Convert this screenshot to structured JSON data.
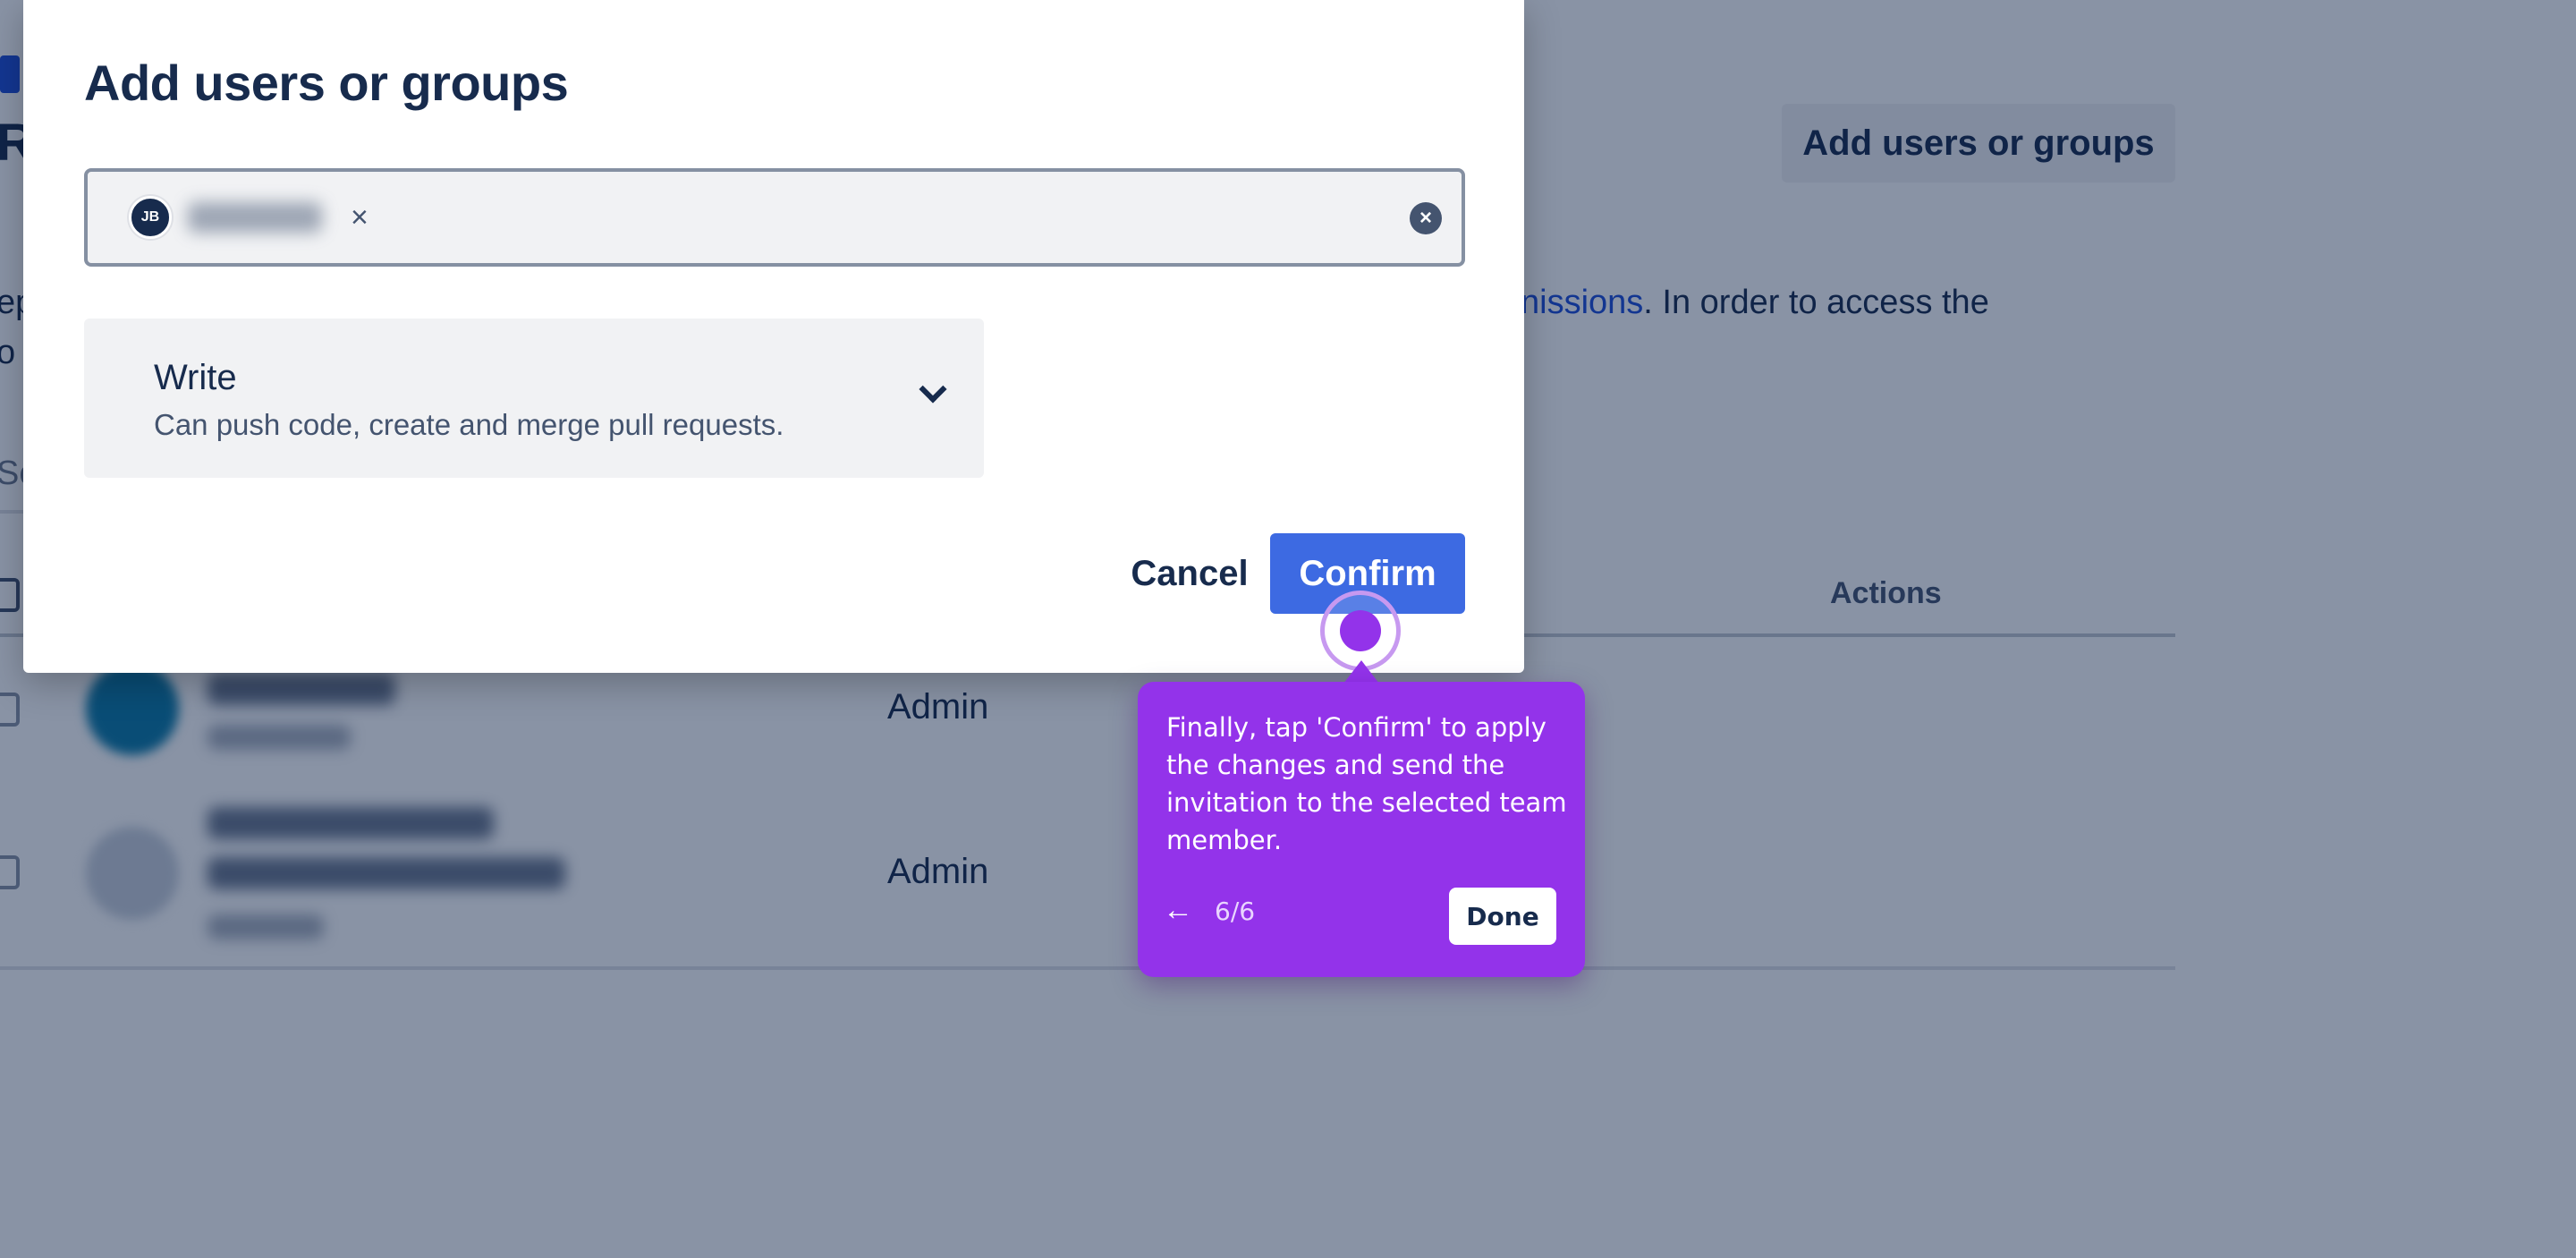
{
  "background": {
    "title": "Re",
    "add_button_label": "Add users or groups",
    "description_left_line1": "ep",
    "description_left_line2": "o",
    "description_link": "nissions",
    "description_right": ". In order to access the",
    "search_fragment": "Se",
    "actions_header": "Actions",
    "rows": [
      {
        "role": "Admin"
      },
      {
        "role": "Admin"
      }
    ]
  },
  "modal": {
    "title": "Add users or groups",
    "picker": {
      "chip_initials": "JB",
      "chip_remove": "×",
      "clear_icon": "×"
    },
    "permission": {
      "name": "Write",
      "description": "Can push code, create and merge pull requests."
    },
    "cancel_label": "Cancel",
    "confirm_label": "Confirm"
  },
  "tooltip": {
    "text": "Finally, tap 'Confirm' to apply the changes and send the invitation to the selected team member.",
    "back_icon": "←",
    "step": "6/6",
    "done_label": "Done"
  },
  "colors": {
    "accent": "#3d6ae2",
    "tooltip": "#9333ea",
    "overlay": "#091e42"
  }
}
